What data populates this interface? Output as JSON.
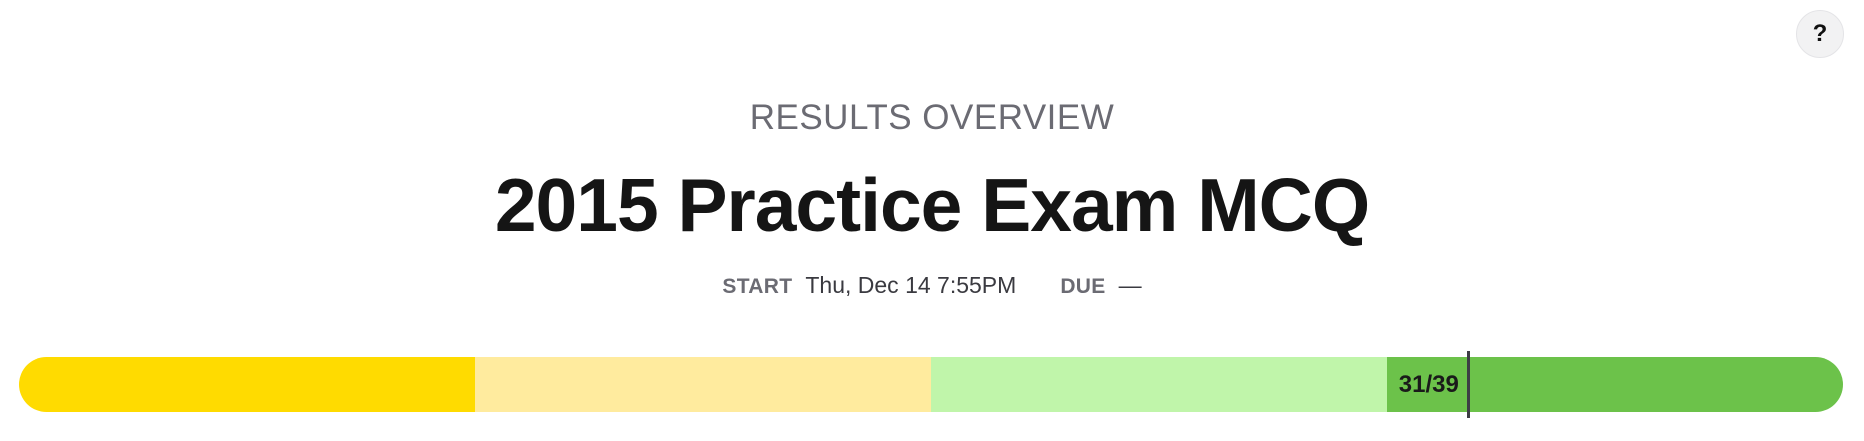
{
  "help": {
    "label": "?"
  },
  "header": {
    "overline": "RESULTS OVERVIEW",
    "title": "2015 Practice Exam MCQ"
  },
  "meta": {
    "start_label": "START",
    "start_value": "Thu, Dec 14 7:55PM",
    "due_label": "DUE",
    "due_value": "—"
  },
  "score": {
    "label": "31/39",
    "correct": 31,
    "total": 39
  },
  "progress_bar": {
    "segments": [
      {
        "name": "band-1",
        "color": "#FFDB00",
        "fraction": 0.25
      },
      {
        "name": "band-2",
        "color": "#FFEB9E",
        "fraction": 0.25
      },
      {
        "name": "band-3",
        "color": "#C0F5AA",
        "fraction": 0.25
      },
      {
        "name": "band-4",
        "color": "#6CC24A",
        "fraction": 0.25
      }
    ]
  }
}
